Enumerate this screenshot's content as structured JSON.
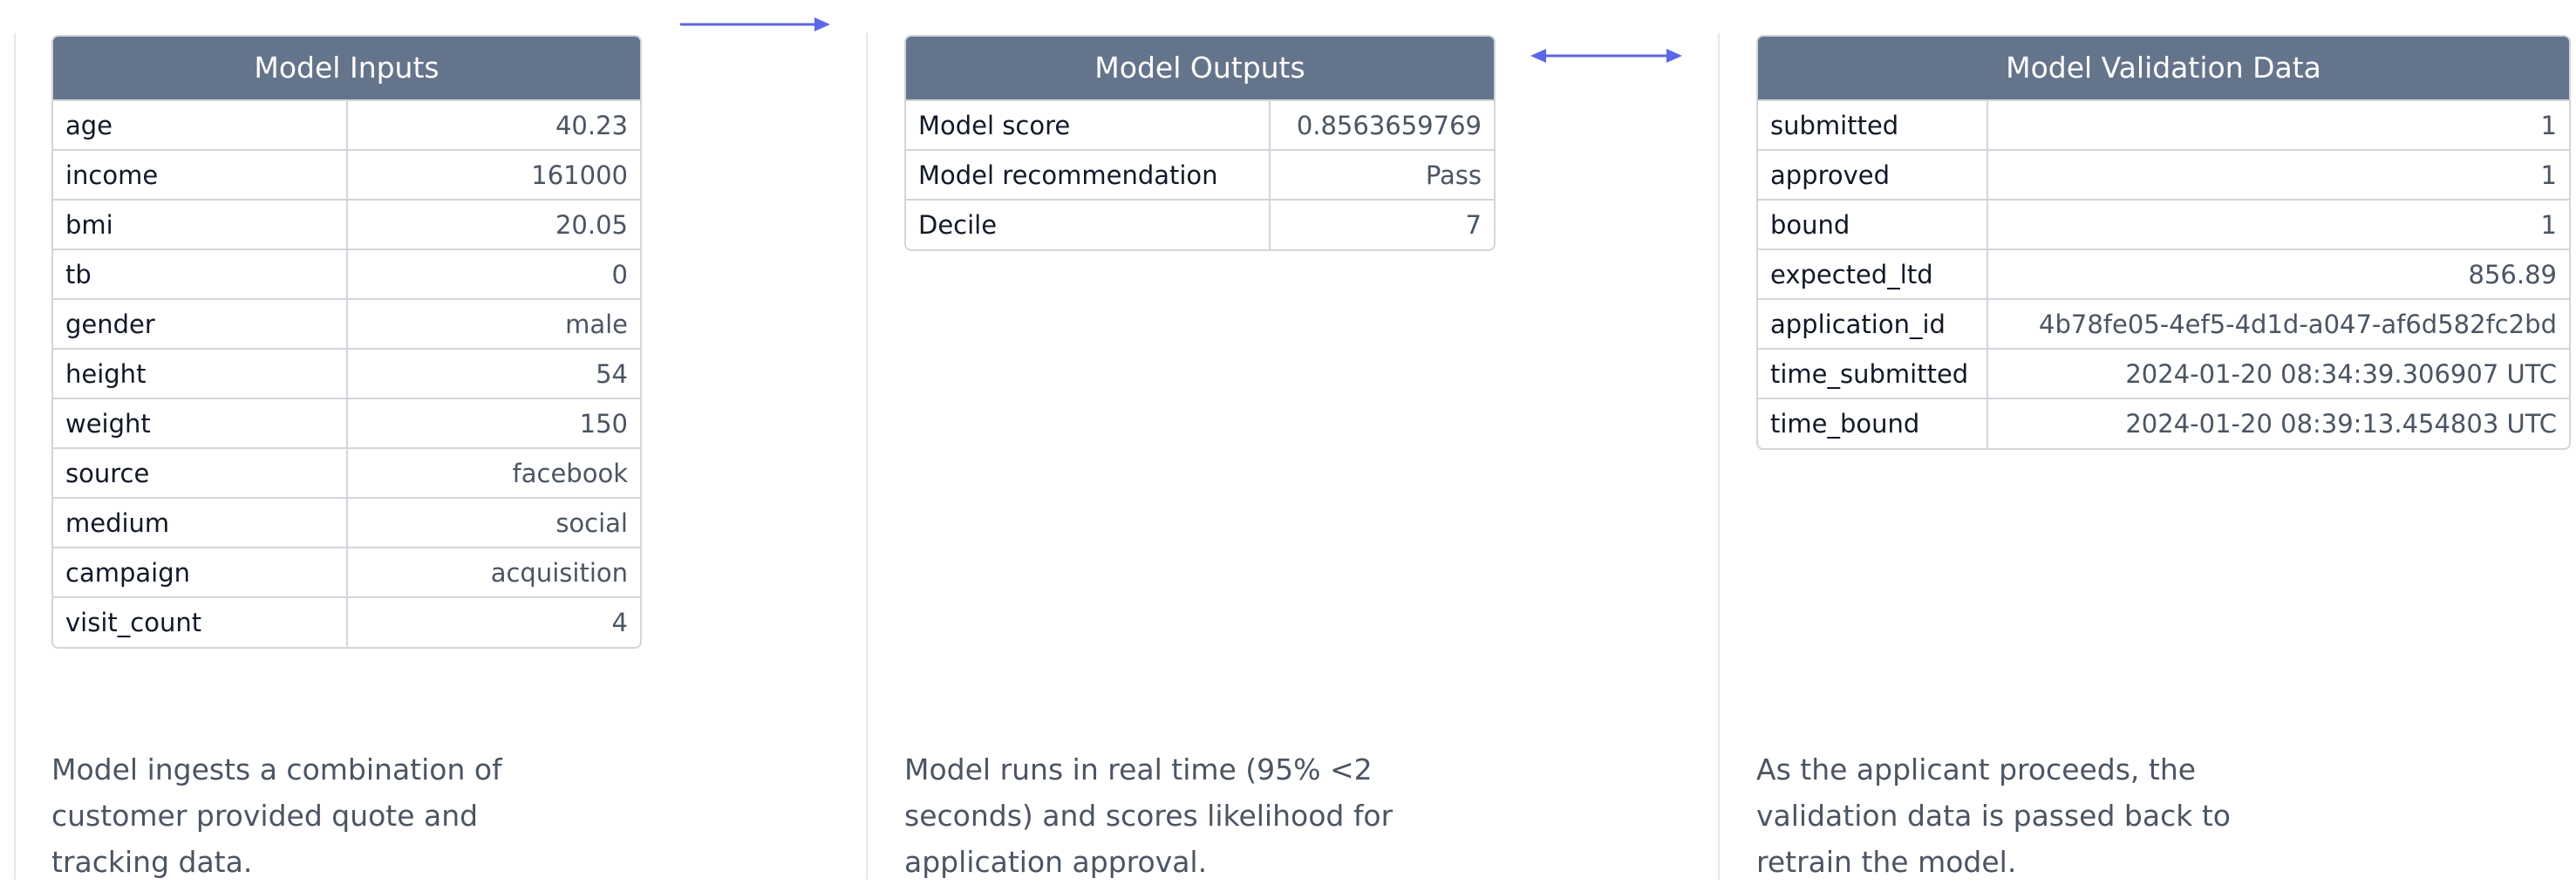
{
  "colors": {
    "header_bg": "#64748b",
    "header_text": "#ffffff",
    "arrow": "#5b67e8",
    "border": "#d1d5db",
    "divider": "#e5e7eb",
    "description_text": "#4b5563"
  },
  "arrows": [
    {
      "name": "arrow-right-icon"
    },
    {
      "name": "arrow-bidirectional-icon"
    }
  ],
  "model_inputs": {
    "title": "Model Inputs",
    "rows": [
      {
        "key": "age",
        "value": "40.23"
      },
      {
        "key": "income",
        "value": "161000"
      },
      {
        "key": "bmi",
        "value": "20.05"
      },
      {
        "key": "tb",
        "value": "0"
      },
      {
        "key": "gender",
        "value": "male"
      },
      {
        "key": "height",
        "value": "54"
      },
      {
        "key": "weight",
        "value": "150"
      },
      {
        "key": "source",
        "value": "facebook"
      },
      {
        "key": "medium",
        "value": "social"
      },
      {
        "key": "campaign",
        "value": "acquisition"
      },
      {
        "key": "visit_count",
        "value": "4"
      }
    ],
    "description": "Model ingests a combination of customer provided quote and tracking data."
  },
  "model_outputs": {
    "title": "Model Outputs",
    "rows": [
      {
        "key": "Model score",
        "value": "0.8563659769"
      },
      {
        "key": "Model recommendation",
        "value": "Pass"
      },
      {
        "key": "Decile",
        "value": "7"
      }
    ],
    "description": "Model runs in real time (95% <2 seconds) and scores likelihood for application approval."
  },
  "model_validation": {
    "title": "Model Validation Data",
    "rows": [
      {
        "key": "submitted",
        "value": "1"
      },
      {
        "key": "approved",
        "value": "1"
      },
      {
        "key": "bound",
        "value": "1"
      },
      {
        "key": "expected_ltd",
        "value": "856.89"
      },
      {
        "key": "application_id",
        "value": "4b78fe05-4ef5-4d1d-a047-af6d582fc2bd"
      },
      {
        "key": "time_submitted",
        "value": "2024-01-20 08:34:39.306907 UTC"
      },
      {
        "key": "time_bound",
        "value": "2024-01-20 08:39:13.454803 UTC"
      }
    ],
    "description": "As the applicant proceeds, the validation data is passed back to retrain the model."
  }
}
